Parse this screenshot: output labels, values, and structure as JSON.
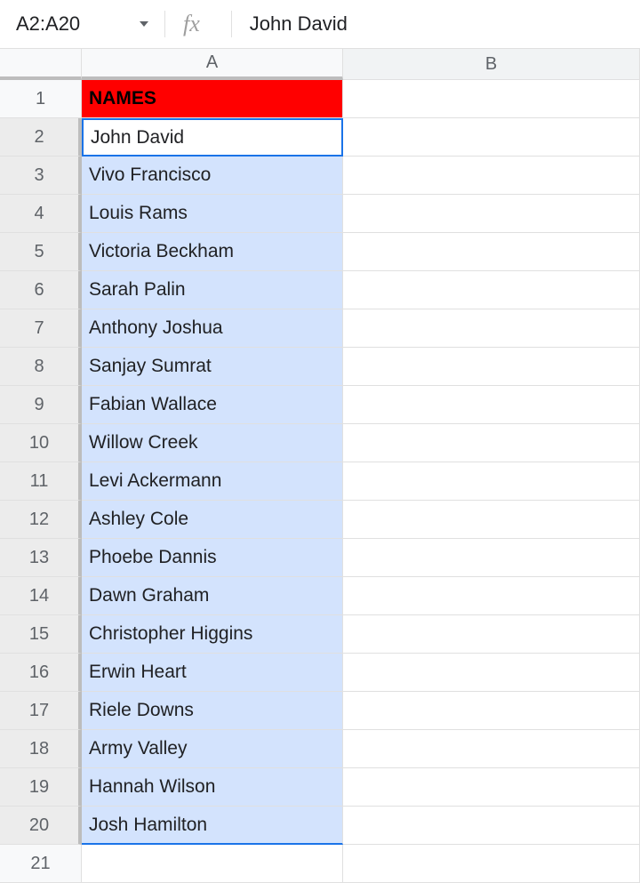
{
  "formula_bar": {
    "name_box": "A2:A20",
    "fx_label": "fx",
    "formula_value": "John David"
  },
  "columns": {
    "a": "A",
    "b": "B"
  },
  "header_cell": "NAMES",
  "rows": [
    {
      "num": "1"
    },
    {
      "num": "2",
      "value": "John David"
    },
    {
      "num": "3",
      "value": "Vivo Francisco"
    },
    {
      "num": "4",
      "value": "Louis Rams"
    },
    {
      "num": "5",
      "value": "Victoria Beckham"
    },
    {
      "num": "6",
      "value": "Sarah Palin"
    },
    {
      "num": "7",
      "value": "Anthony Joshua"
    },
    {
      "num": "8",
      "value": "Sanjay Sumrat"
    },
    {
      "num": "9",
      "value": "Fabian Wallace"
    },
    {
      "num": "10",
      "value": "Willow Creek"
    },
    {
      "num": "11",
      "value": "Levi Ackermann"
    },
    {
      "num": "12",
      "value": "Ashley Cole"
    },
    {
      "num": "13",
      "value": "Phoebe Dannis"
    },
    {
      "num": "14",
      "value": "Dawn Graham"
    },
    {
      "num": "15",
      "value": "Christopher Higgins"
    },
    {
      "num": "16",
      "value": "Erwin Heart"
    },
    {
      "num": "17",
      "value": "Riele Downs"
    },
    {
      "num": "18",
      "value": "Army Valley"
    },
    {
      "num": "19",
      "value": "Hannah Wilson"
    },
    {
      "num": "20",
      "value": "Josh Hamilton"
    },
    {
      "num": "21"
    }
  ]
}
